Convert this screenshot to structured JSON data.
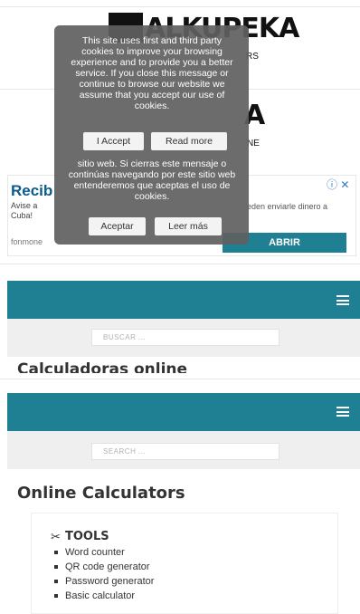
{
  "logo": {
    "top_partial": "ALKUPEKA",
    "top_suffix": "RS",
    "mid_partial": "A",
    "mid_suffix": "NE"
  },
  "cookie_popup": {
    "en_text": "This site uses first and third party cookies to improve your browsing experience and to provide you a better service. If you close this message or continue to browse our website we assume that you accept our use of cookies.",
    "en_accept": "I Accept",
    "en_read_more": "Read more",
    "es_text": "sitio web. Si cierras este mensaje o continúas navegando por este sitio web entenderemos que aceptas el uso de cookies.",
    "es_accept": "Aceptar",
    "es_read_more": "Leer más"
  },
  "ad": {
    "title": "Recib",
    "text_left": "Avise a",
    "text_left_2": "Cuba!",
    "text_right": "eden enviarle dinero a",
    "link": "fonmone",
    "button": "ABRIR",
    "icons": "ⓘ ✕"
  },
  "spanish_section": {
    "search_placeholder": "BUSCAR ...",
    "heading": "Calculadoras online"
  },
  "english_section": {
    "search_placeholder": "SEARCH ...",
    "heading": "Online Calculators",
    "tools_title": "TOOLS",
    "tools": [
      "Word counter",
      "QR code generator",
      "Password generator",
      "Basic calculator"
    ]
  },
  "colors": {
    "teal": "#1f7f93",
    "popup": "#5f5f5f"
  }
}
